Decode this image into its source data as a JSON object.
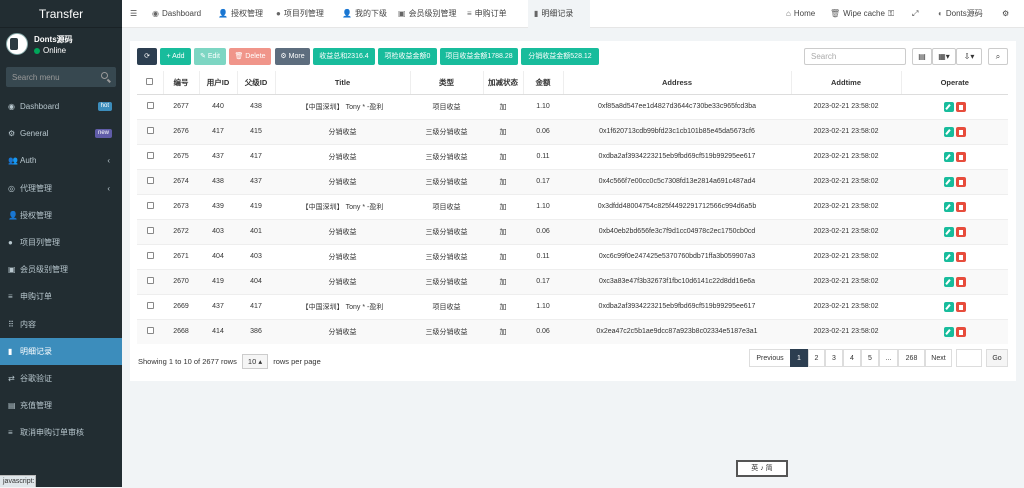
{
  "sidebar": {
    "brand": "Transfer",
    "user": {
      "name": "Donts源码",
      "status": "Online"
    },
    "search_placeholder": "Search menu",
    "items": [
      {
        "label": "Dashboard",
        "icon": "dashboard-icon",
        "badge": "hot",
        "badge_color": "#3c8dbc"
      },
      {
        "label": "General",
        "icon": "cogs-icon",
        "badge": "new",
        "badge_color": "#605ca8"
      },
      {
        "label": "Auth",
        "icon": "group-icon",
        "caret": "‹"
      },
      {
        "label": "代理管理",
        "icon": "user-circle-icon",
        "caret": "‹"
      },
      {
        "label": "授权管理",
        "icon": "users-icon"
      },
      {
        "label": "项目列管理",
        "icon": "circle-icon"
      },
      {
        "label": "会员级别管理",
        "icon": "calendar-icon"
      },
      {
        "label": "申购订单",
        "icon": "list-icon"
      },
      {
        "label": "内容",
        "icon": "grid-icon"
      },
      {
        "label": "明细记录",
        "icon": "bar-chart-icon",
        "active": true
      },
      {
        "label": "谷歌验证",
        "icon": "exchange-icon"
      },
      {
        "label": "充值管理",
        "icon": "list-alt-icon"
      },
      {
        "label": "取消申购订单审核",
        "icon": "list-icon"
      }
    ]
  },
  "statusbar": "javascript:",
  "topbar": {
    "tabs": [
      {
        "label": "Dashboard",
        "icon": "dashboard-icon"
      },
      {
        "label": "授权管理",
        "icon": "users-icon"
      },
      {
        "label": "项目列管理",
        "icon": "circle-icon"
      },
      {
        "label": "我的下级",
        "icon": "users-icon"
      },
      {
        "label": "会员级别管理",
        "icon": "calendar-icon"
      },
      {
        "label": "申购订单",
        "icon": "list-icon"
      },
      {
        "label": "明细记录",
        "icon": "bar-chart-icon",
        "active": true
      }
    ],
    "home": "Home",
    "wipe": "Wipe cache",
    "user": "Donts源码"
  },
  "toolbar": {
    "add": "Add",
    "edit": "Edit",
    "delete": "Delete",
    "more": "More",
    "stats": [
      "收益总和2316.4",
      "项检收益金额0",
      "项目收益金额1788.28",
      "分销收益金额528.12"
    ],
    "search_placeholder": "Search"
  },
  "table": {
    "headers": [
      "编号",
      "用户ID",
      "父级ID",
      "Title",
      "类型",
      "加减状态",
      "金额",
      "Address",
      "Addtime",
      "Operate"
    ],
    "rows": [
      [
        "2677",
        "440",
        "438",
        "【中国深圳】 Tony * -盈利",
        "项目收益",
        "加",
        "1.10",
        "0xf85a8d547ee1d4827d3644c730be33c965fcd3ba",
        "2023-02-21 23:58:02"
      ],
      [
        "2676",
        "417",
        "415",
        "分销收益",
        "三级分销收益",
        "加",
        "0.06",
        "0x1f620713cdb99bfd23c1cb101b85e45da5673cf6",
        "2023-02-21 23:58:02"
      ],
      [
        "2675",
        "437",
        "417",
        "分销收益",
        "三级分销收益",
        "加",
        "0.11",
        "0xdba2af3934223215eb9fbd69cf519b99295ee617",
        "2023-02-21 23:58:02"
      ],
      [
        "2674",
        "438",
        "437",
        "分销收益",
        "三级分销收益",
        "加",
        "0.17",
        "0x4c566f7e00cc0c5c7308fd13e2814a691c487ad4",
        "2023-02-21 23:58:02"
      ],
      [
        "2673",
        "439",
        "419",
        "【中国深圳】 Tony * -盈利",
        "项目收益",
        "加",
        "1.10",
        "0x3dfdd48004754c825f4492291712566c994d6a5b",
        "2023-02-21 23:58:02"
      ],
      [
        "2672",
        "403",
        "401",
        "分销收益",
        "三级分销收益",
        "加",
        "0.06",
        "0xb40eb2bd656fe3c7f9d1cc04978c2ec1750cb0cd",
        "2023-02-21 23:58:02"
      ],
      [
        "2671",
        "404",
        "403",
        "分销收益",
        "三级分销收益",
        "加",
        "0.11",
        "0xc6c99f0e247425e5370760bdb71ffa3b059907a3",
        "2023-02-21 23:58:02"
      ],
      [
        "2670",
        "419",
        "404",
        "分销收益",
        "三级分销收益",
        "加",
        "0.17",
        "0xc3a83e47f3b32673f1fbc10d6141c22d8dd16e6a",
        "2023-02-21 23:58:02"
      ],
      [
        "2669",
        "437",
        "417",
        "【中国深圳】 Tony * -盈利",
        "项目收益",
        "加",
        "1.10",
        "0xdba2af3934223215eb9fbd69cf519b99295ee617",
        "2023-02-21 23:58:02"
      ],
      [
        "2668",
        "414",
        "386",
        "分销收益",
        "三级分销收益",
        "加",
        "0.06",
        "0x2ea47c2c5b1ae9dcc87a923b8c02334e5187e3a1",
        "2023-02-21 23:58:02"
      ]
    ]
  },
  "footer": {
    "showing": "Showing 1 to 10 of 2677 rows",
    "page_size": "10",
    "rows_per_page": "rows per page",
    "pages": [
      "Previous",
      "1",
      "2",
      "3",
      "4",
      "5",
      "...",
      "268",
      "Next"
    ],
    "go": "Go"
  },
  "stamp": "英 ♪ 简"
}
